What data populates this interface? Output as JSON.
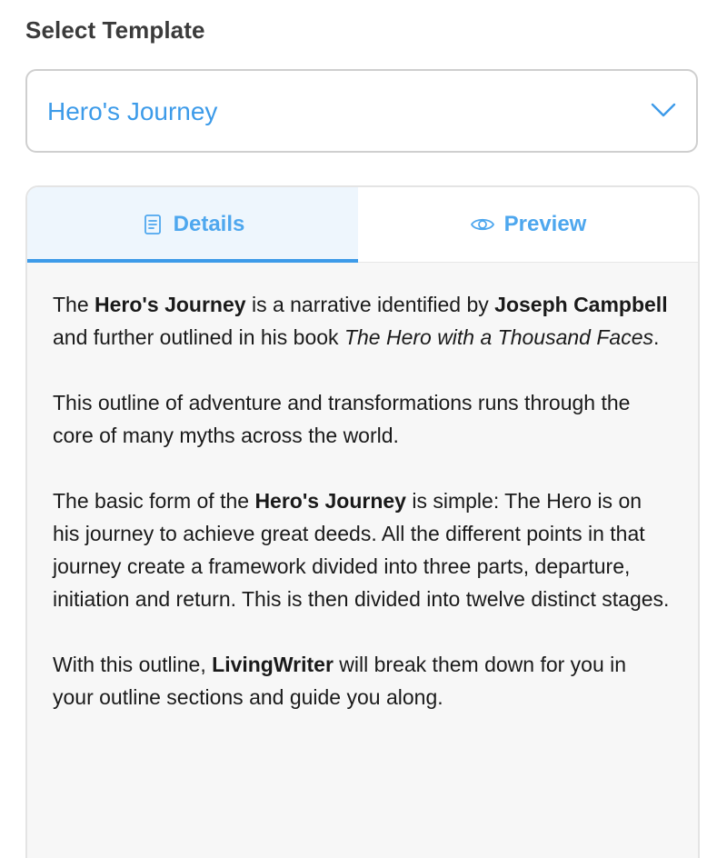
{
  "select": {
    "label": "Select Template",
    "value": "Hero's Journey"
  },
  "tabs": {
    "details": {
      "label": "Details",
      "icon": "document-icon",
      "active": true
    },
    "preview": {
      "label": "Preview",
      "icon": "eye-icon",
      "active": false
    }
  },
  "colors": {
    "accent": "#3d9be9",
    "tab_active_bg": "#eef6fd",
    "content_bg": "#f7f7f7",
    "border": "#cfcfcf"
  },
  "details": {
    "p1": {
      "t1": "The ",
      "b1": "Hero's Journey",
      "t2": " is a narrative identified by ",
      "b2": "Joseph Campbell",
      "t3": " and further outlined in his book ",
      "i1": "The Hero with a Thousand Faces",
      "t4": "."
    },
    "p2": "This outline of adventure and transformations runs through the core of many myths across the world.",
    "p3": {
      "t1": "The basic form of the ",
      "b1": "Hero's Journey",
      "t2": " is simple: The Hero is on his journey to achieve great deeds. All the different points in that journey create a framework divided into three parts, departure, initiation and return. This is then divided into twelve distinct stages."
    },
    "p4": {
      "t1": "With this outline, ",
      "b1": "LivingWriter",
      "t2": " will break them down for you in your outline sections and guide you along."
    }
  }
}
